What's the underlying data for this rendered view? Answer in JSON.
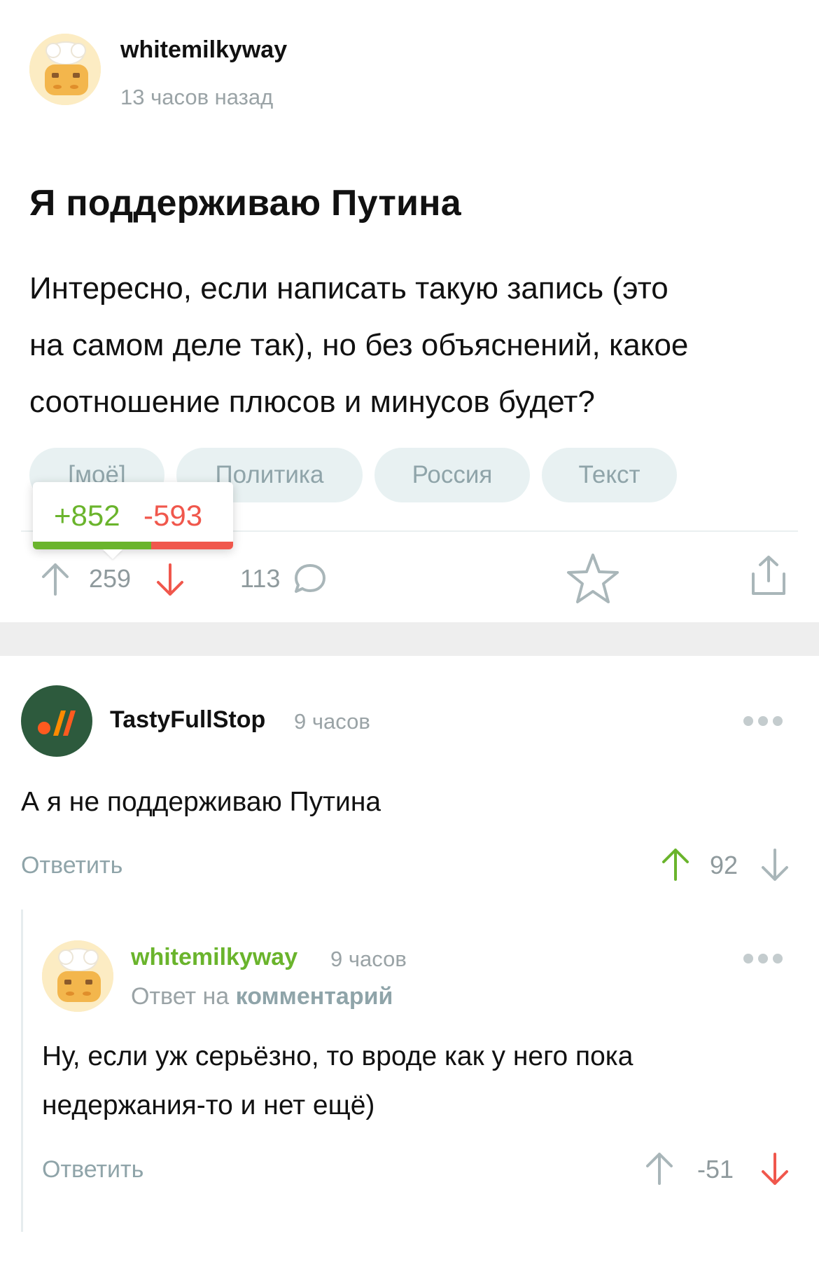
{
  "post": {
    "author": "whitemilkyway",
    "time": "13 часов назад",
    "title": "Я поддерживаю Путина",
    "text_lines": [
      "Интересно, если написать такую запись (это",
      "на самом деле так), но без объяснений, какое",
      "соотношение плюсов и минусов будет?"
    ],
    "tags": [
      "[моё]",
      "Политика",
      "Россия",
      "Текст"
    ],
    "rating_popup": {
      "plus": "+852",
      "minus": "-593",
      "plus_fraction": 0.59
    },
    "rating": "259",
    "comments_count": "113"
  },
  "comments": [
    {
      "author": "TastyFullStop",
      "time": "9 часов",
      "text": "А я не поддерживаю Путина",
      "reply_label": "Ответить",
      "rating": "92"
    }
  ],
  "reply": {
    "author": "whitemilkyway",
    "time": "9 часов",
    "reply_prefix": "Ответ на",
    "reply_link": "комментарий",
    "text_lines": [
      "Ну, если уж серьёзно, то вроде как у него пока",
      "недержания-то и нет ещё)"
    ],
    "reply_label": "Ответить",
    "rating": "-51"
  },
  "colors": {
    "green": "#6ab42c",
    "red": "#f0574c",
    "muted": "#8fa4a9",
    "tag_bg": "#e8f1f2"
  },
  "icons": [
    "upvote-arrow-icon",
    "downvote-arrow-icon",
    "comment-bubble-icon",
    "star-icon",
    "share-icon",
    "more-dots-icon"
  ]
}
